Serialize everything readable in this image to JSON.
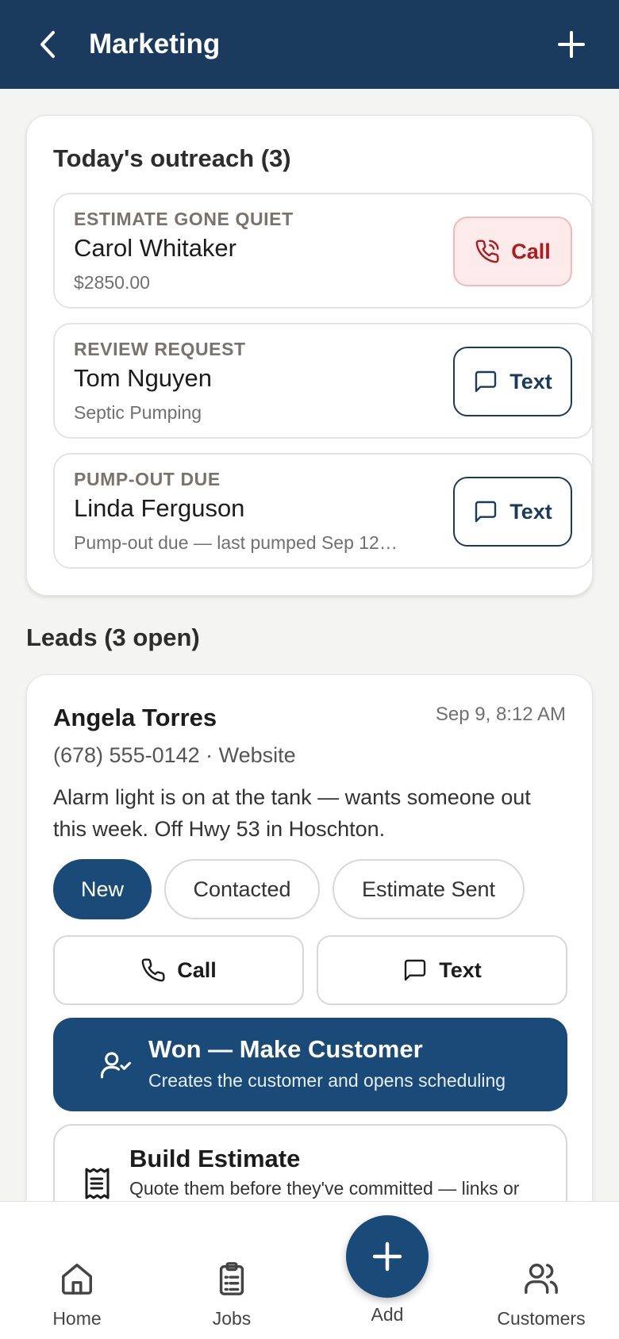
{
  "header": {
    "title": "Marketing"
  },
  "outreach": {
    "title": "Today's outreach (3)",
    "items": [
      {
        "kind": "ESTIMATE GONE QUIET",
        "name": "Carol Whitaker",
        "detail": "$2850.00",
        "action": "Call"
      },
      {
        "kind": "REVIEW REQUEST",
        "name": "Tom Nguyen",
        "detail": "Septic Pumping",
        "action": "Text"
      },
      {
        "kind": "PUMP-OUT DUE",
        "name": "Linda Ferguson",
        "detail": "Pump-out due — last pumped Sep 12…",
        "action": "Text"
      }
    ]
  },
  "leads": {
    "title": "Leads (3 open)",
    "lead": {
      "name": "Angela Torres",
      "time": "Sep 9, 8:12 AM",
      "meta": "(678) 555-0142 · Website",
      "note": "Alarm light is on at the tank — wants someone out this week. Off Hwy 53 in Hoschton.",
      "statuses": [
        "New",
        "Contacted",
        "Estimate Sent"
      ],
      "active_status": "New",
      "call_label": "Call",
      "text_label": "Text",
      "won_title": "Won — Make Customer",
      "won_subtitle": "Creates the customer and opens scheduling",
      "estimate_title": "Build Estimate",
      "estimate_subtitle": "Quote them before they've committed — links or"
    }
  },
  "nav": {
    "home": "Home",
    "jobs": "Jobs",
    "add": "Add",
    "customers": "Customers"
  },
  "colors": {
    "header": "#1a3a5e",
    "primary": "#1a4a78",
    "call_red": "#b3181c",
    "call_bg": "#fdeaea"
  }
}
